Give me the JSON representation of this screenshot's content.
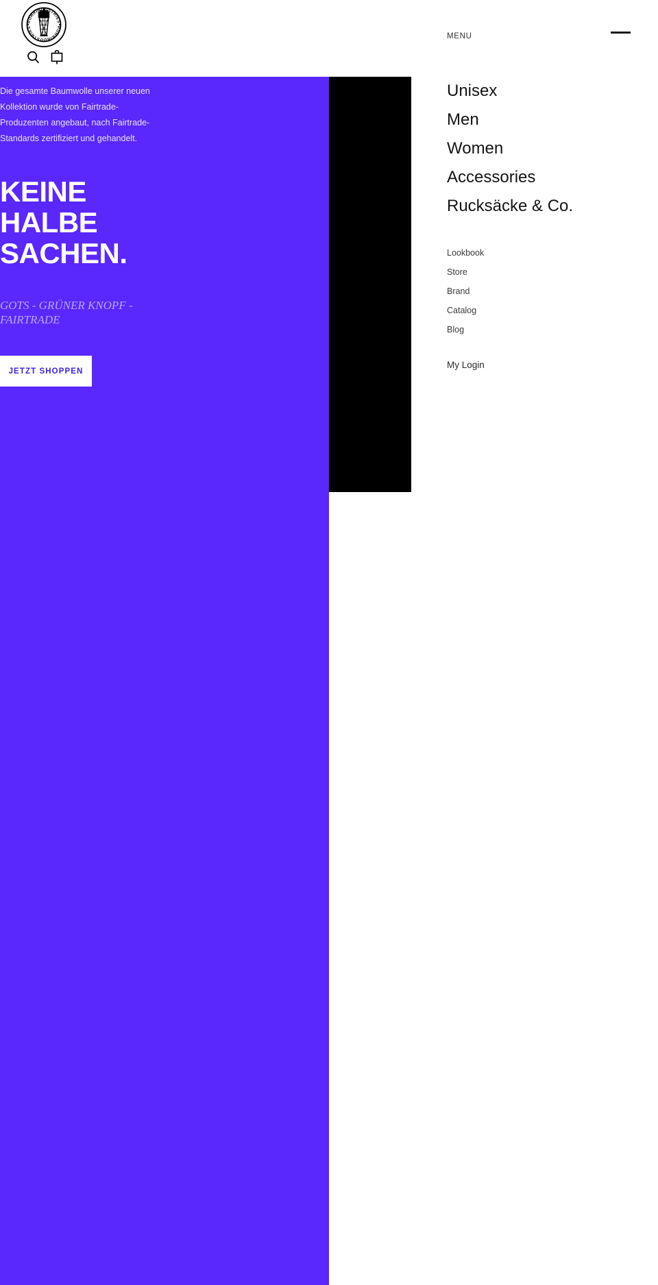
{
  "header": {
    "logo_alt": "RUHRINDUSTRIES",
    "logo_ring_text": "RUHRINDUSTRIES",
    "menu_label": "MENU",
    "search_icon": "search-icon",
    "bag_icon": "shopping-bag-icon",
    "toggle_icon": "menu-close-line-icon"
  },
  "hero": {
    "intro": "Die gesamte Baumwolle unserer neuen Kollektion wurde von Fairtrade-Produzenten angebaut, nach Fairtrade-Standards zertifiziert und gehandelt.",
    "headline_lines": [
      "KEINE",
      "HALBE",
      "SACHEN."
    ],
    "headline": "KEINE HALBE SACHEN.",
    "tagline": "GOTS - GRÜNER KNOPF - FAIRTRADE",
    "cta_label": "JETZT SHOPPEN"
  },
  "nav": {
    "primary": [
      {
        "label": "Unisex"
      },
      {
        "label": "Men"
      },
      {
        "label": "Women"
      },
      {
        "label": "Accessories"
      },
      {
        "label": "Rucksäcke & Co."
      }
    ],
    "secondary": [
      {
        "label": "Lookbook"
      },
      {
        "label": "Store"
      },
      {
        "label": "Brand"
      },
      {
        "label": "Catalog"
      },
      {
        "label": "Blog"
      }
    ],
    "account": [
      {
        "label": "My Login"
      }
    ]
  },
  "colors": {
    "accent_purple": "#5a27fd",
    "panel_black": "#000000",
    "cta_background": "#ffffff",
    "cta_text": "#3a1fe0",
    "tagline_text": "#b9a7ff"
  }
}
